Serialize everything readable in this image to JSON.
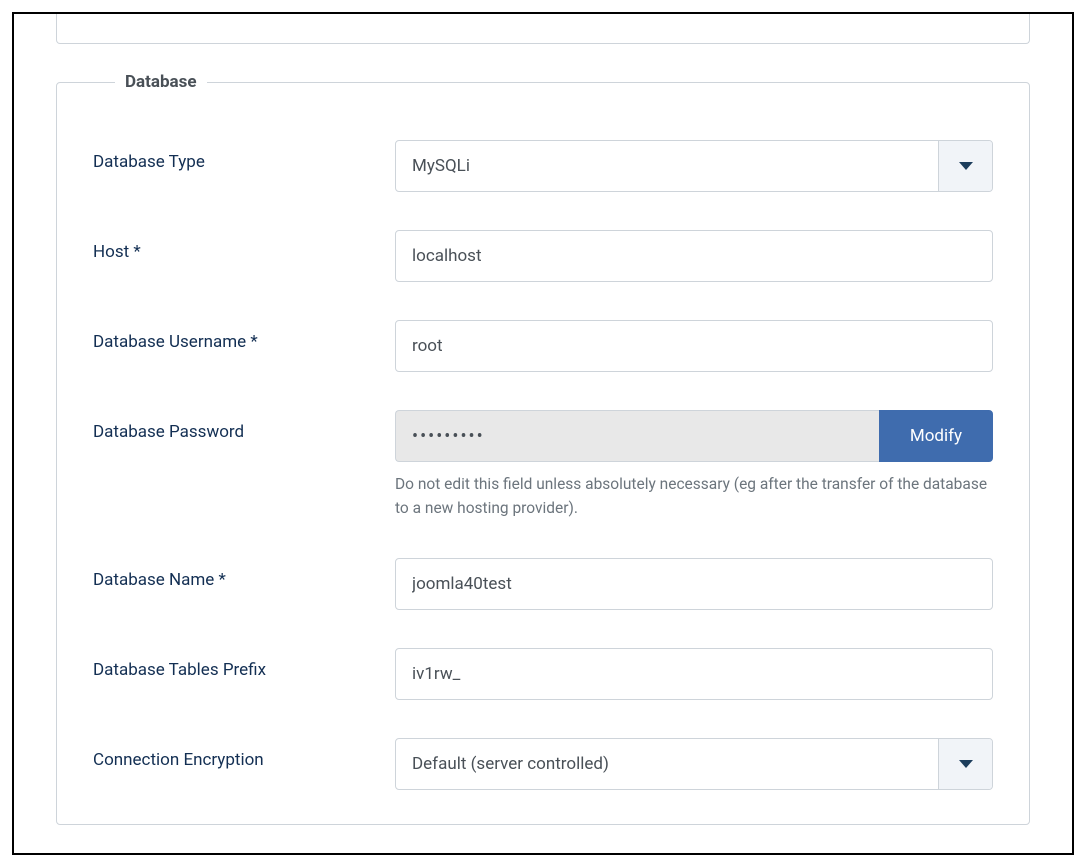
{
  "fieldset": {
    "legend": "Database"
  },
  "fields": {
    "dbtype": {
      "label": "Database Type",
      "value": "MySQLi"
    },
    "host": {
      "label": "Host *",
      "value": "localhost"
    },
    "username": {
      "label": "Database Username *",
      "value": "root"
    },
    "password": {
      "label": "Database Password",
      "value": "•••••••••",
      "modify": "Modify",
      "help": "Do not edit this field unless absolutely necessary (eg after the transfer of the database to a new hosting provider)."
    },
    "dbname": {
      "label": "Database Name *",
      "value": "joomla40test"
    },
    "prefix": {
      "label": "Database Tables Prefix",
      "value": "iv1rw_"
    },
    "encryption": {
      "label": "Connection Encryption",
      "value": "Default (server controlled)"
    }
  }
}
